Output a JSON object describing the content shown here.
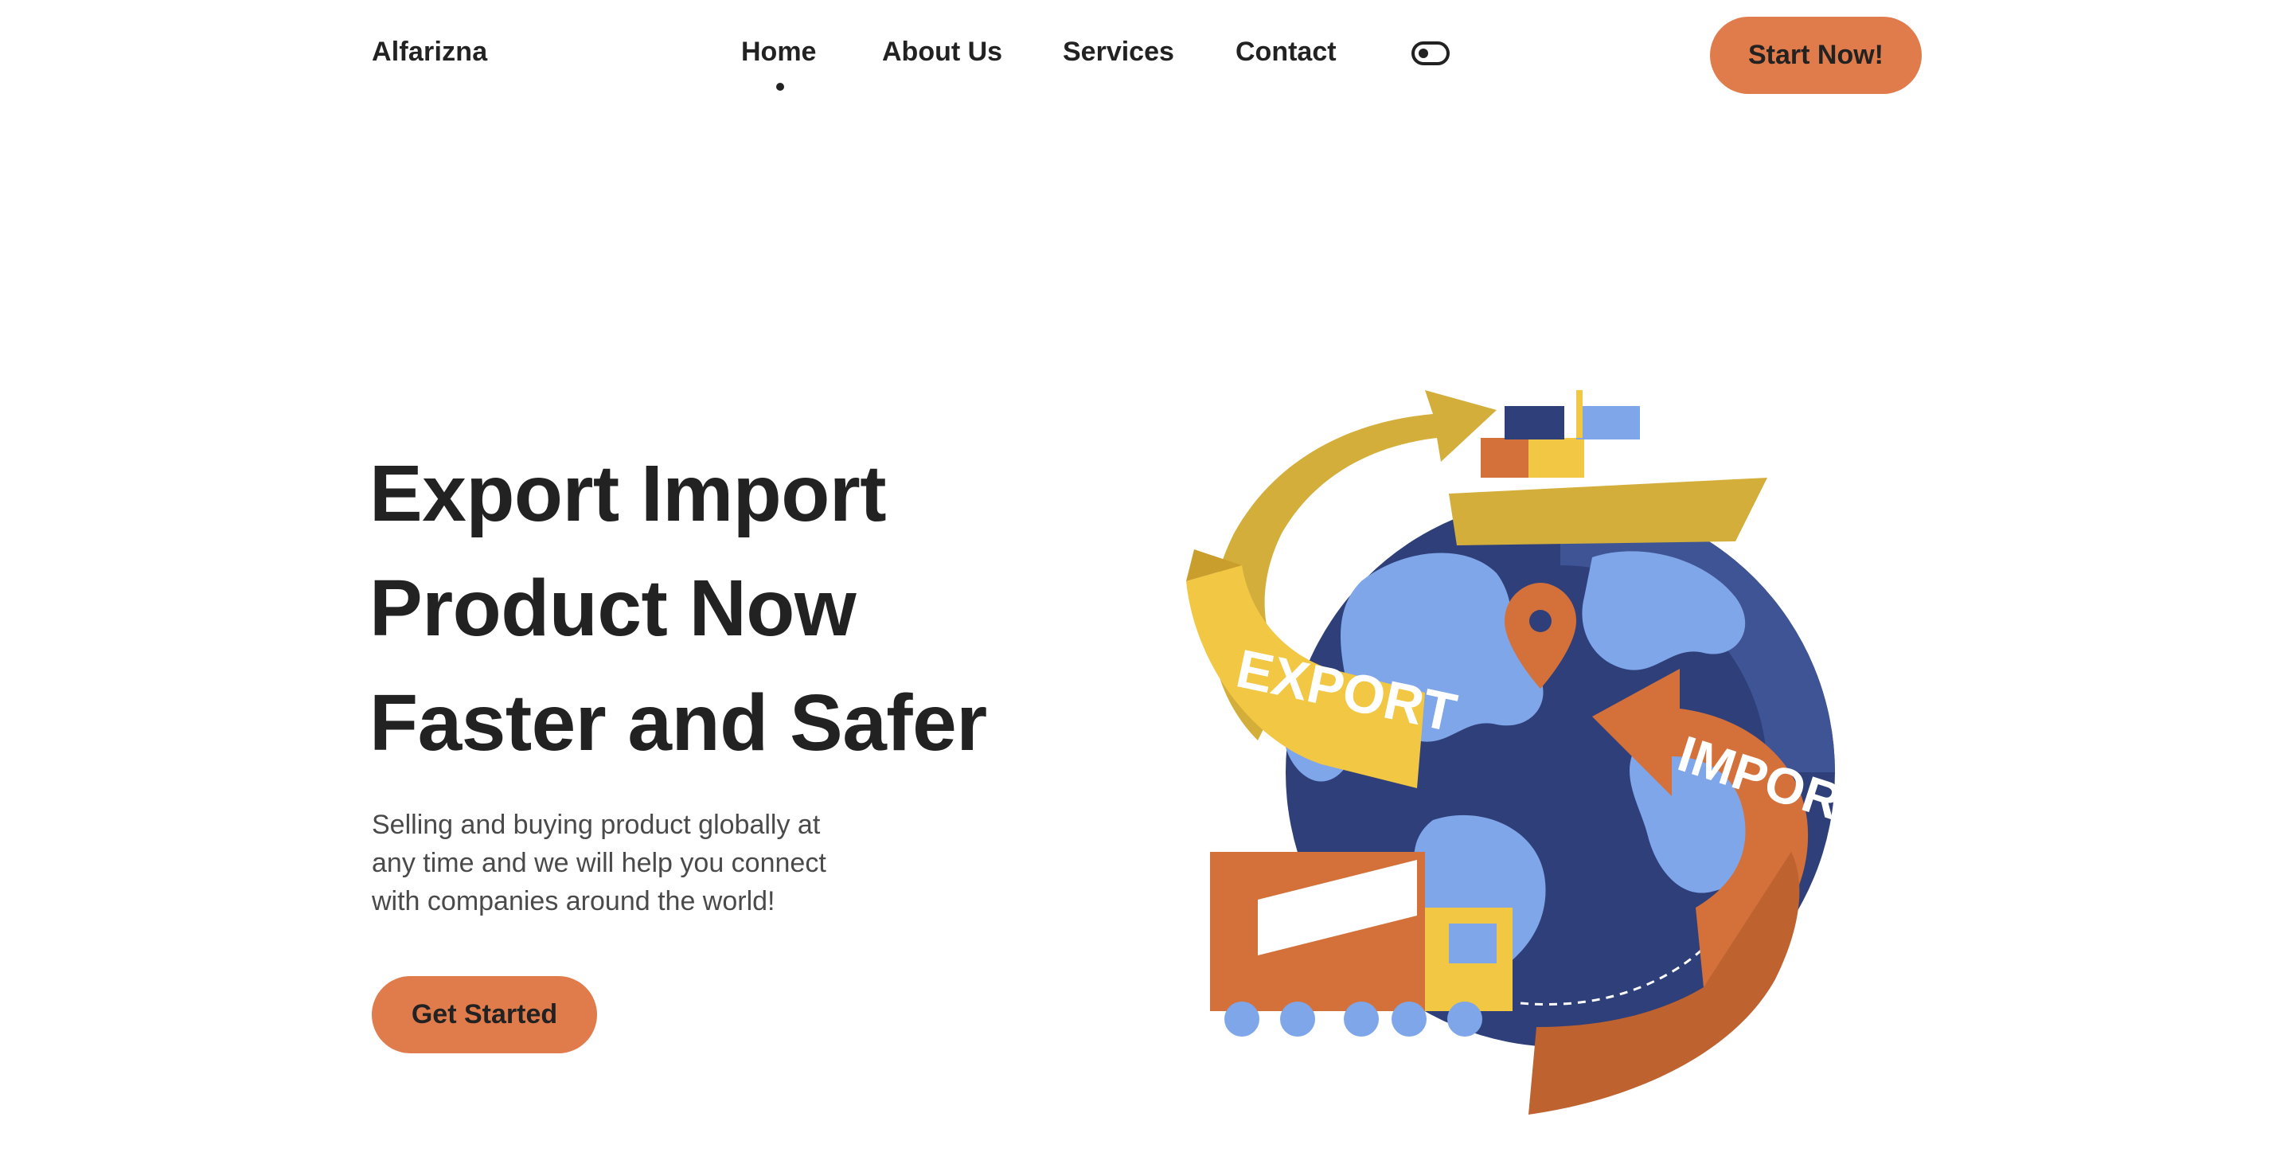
{
  "header": {
    "logo": "Alfarizna",
    "nav": [
      {
        "label": "Home",
        "active": true
      },
      {
        "label": "About Us",
        "active": false
      },
      {
        "label": "Services",
        "active": false
      },
      {
        "label": "Contact",
        "active": false
      }
    ],
    "theme_toggle_icon": "toggle-switch-icon",
    "cta_label": "Start Now!"
  },
  "hero": {
    "title_lines": [
      "Export Import",
      "Product Now",
      "Faster and Safer"
    ],
    "description_lines": [
      "Selling and buying product globally at",
      "any time and we will help you connect",
      "with companies around the world!"
    ],
    "button_label": "Get Started"
  },
  "illustration": {
    "export_label": "EXPORT",
    "import_label": "IMPORT"
  },
  "colors": {
    "accent": "#E07B4C",
    "text": "#222222",
    "globe_dark": "#2F3F7A",
    "globe_light": "#7EA6E8",
    "ribbon_yellow": "#F2C744",
    "ribbon_orange": "#D4703A"
  }
}
